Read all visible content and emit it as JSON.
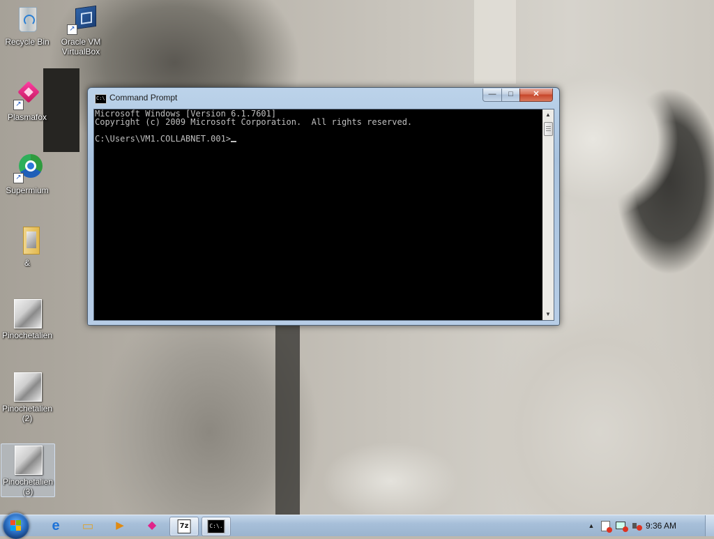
{
  "desktop": {
    "icons": [
      {
        "label": "Recycle Bin",
        "icon": "recycle-bin-icon"
      },
      {
        "label": "Oracle VM VirtualBox",
        "icon": "virtualbox-icon"
      },
      {
        "label": "Plasmafox",
        "icon": "plasmafox-icon"
      },
      {
        "label": "Supermium",
        "icon": "supermium-icon"
      },
      {
        "label": "&",
        "icon": "folder-icon"
      },
      {
        "label": "Pinochetalien",
        "icon": "image-file-icon"
      },
      {
        "label": "Pinochetalien (2)",
        "icon": "image-file-icon"
      },
      {
        "label": "Pinochetalien (3)",
        "icon": "image-file-icon"
      }
    ]
  },
  "window": {
    "title": "Command Prompt",
    "title_icon_text": "C:\\.",
    "controls": {
      "minimize": "—",
      "maximize": "□",
      "close": "✕"
    },
    "console_lines": [
      "Microsoft Windows [Version 6.1.7601]",
      "Copyright (c) 2009 Microsoft Corporation.  All rights reserved.",
      "",
      "C:\\Users\\VM1.COLLABNET.001>"
    ],
    "scroll_up": "▲",
    "scroll_down": "▼"
  },
  "taskbar": {
    "pinned": [
      {
        "name": "internet-explorer-icon",
        "glyph": "e"
      },
      {
        "name": "file-explorer-icon",
        "glyph": "▭"
      },
      {
        "name": "media-player-icon",
        "glyph": "▶"
      },
      {
        "name": "plasmafox-taskbar-icon",
        "glyph": "◆"
      },
      {
        "name": "7zip-icon",
        "glyph": "7z"
      },
      {
        "name": "command-prompt-taskbar-icon",
        "glyph": "C:\\."
      }
    ],
    "tray": {
      "show_hidden": "▲",
      "clock": "9:36 AM"
    }
  },
  "colors": {
    "console_bg": "#000000",
    "console_fg": "#c0c0c0",
    "taskbar": "#a7bfd9",
    "close_button": "#c7452a"
  }
}
